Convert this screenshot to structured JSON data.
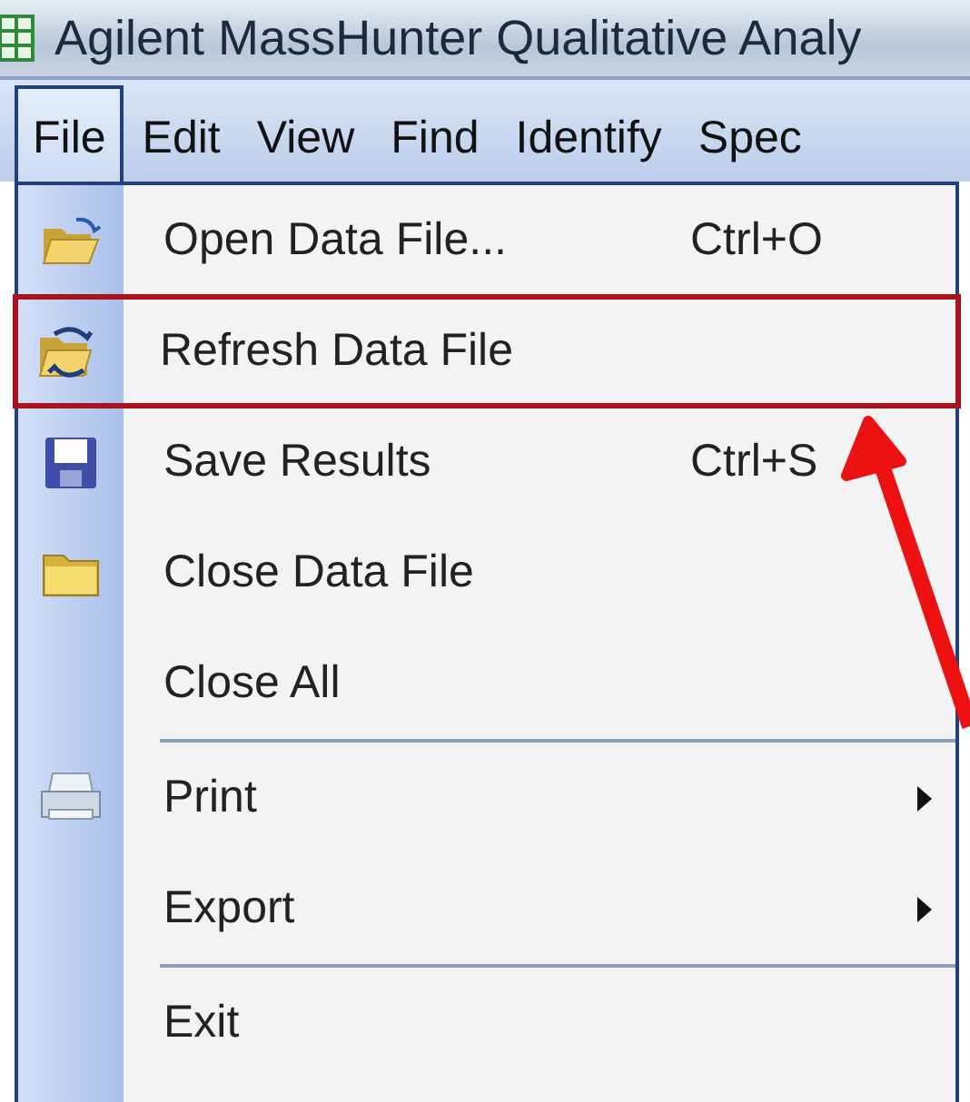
{
  "window": {
    "title": "Agilent MassHunter Qualitative Analy"
  },
  "menubar": [
    {
      "label": "File",
      "selected": true
    },
    {
      "label": "Edit",
      "selected": false
    },
    {
      "label": "View",
      "selected": false
    },
    {
      "label": "Find",
      "selected": false
    },
    {
      "label": "Identify",
      "selected": false
    },
    {
      "label": "Spec",
      "selected": false
    }
  ],
  "menu": [
    {
      "kind": "item",
      "label": "Open Data File...",
      "shortcut": "Ctrl+O",
      "submenu": false,
      "annotated": false
    },
    {
      "kind": "item",
      "label": "Refresh Data File",
      "submenu": false,
      "annotated": true
    },
    {
      "kind": "item",
      "label": "Save Results",
      "shortcut": "Ctrl+S",
      "submenu": false,
      "annotated": false
    },
    {
      "kind": "item",
      "label": "Close Data File",
      "submenu": false,
      "annotated": false
    },
    {
      "kind": "item",
      "label": "Close All",
      "submenu": false,
      "annotated": false
    },
    {
      "kind": "separator"
    },
    {
      "kind": "item",
      "label": "Print",
      "submenu": true,
      "annotated": false
    },
    {
      "kind": "item",
      "label": "Export",
      "submenu": true,
      "annotated": false
    },
    {
      "kind": "separator"
    },
    {
      "kind": "item",
      "label": "Exit",
      "submenu": false,
      "annotated": false
    }
  ]
}
